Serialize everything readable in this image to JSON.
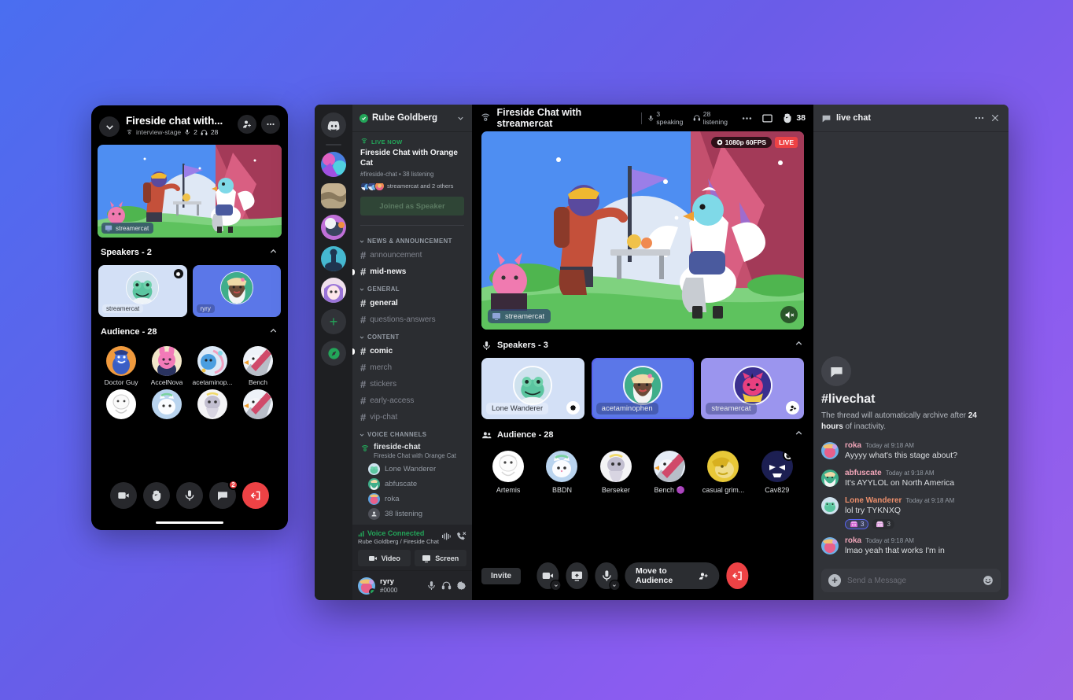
{
  "mobile": {
    "title": "Fireside chat with...",
    "channel": "interview-stage",
    "speaking_count": "2",
    "listening_count": "28",
    "stream_label": "streamercat",
    "speakers_section": {
      "label": "Speakers - 2"
    },
    "speakers": [
      {
        "name": "streamercat",
        "badge": "stage-moderator-icon"
      },
      {
        "name": "ryry",
        "badge": ""
      }
    ],
    "audience_section": {
      "label": "Audience - 28"
    },
    "audience": [
      {
        "name": "Doctor Guy"
      },
      {
        "name": "AccelNova"
      },
      {
        "name": "acetaminop..."
      },
      {
        "name": "Bench"
      }
    ],
    "toolbar": {
      "video": "video-icon",
      "raise_hand": "raise-hand-icon",
      "mic": "microphone-icon",
      "chat": "chat-icon",
      "chat_badge": "2",
      "leave": "leave-call-icon"
    }
  },
  "rail": {
    "home_label": "discord-home",
    "items": [
      "server-1",
      "server-2",
      "server-3",
      "server-4",
      "server-5"
    ],
    "add_label": "+",
    "explore_label": "explore-servers"
  },
  "sidebar": {
    "server_name": "Rube Goldberg",
    "live_card": {
      "live_now": "LIVE NOW",
      "title": "Fireside Chat with Orange Cat",
      "meta": "#fireside-chat  •  38 listening",
      "people": "streamercat and 2 others",
      "button": "Joined as Speaker"
    },
    "categories": [
      {
        "name": "NEWS & ANNOUNCEMENT",
        "channels": [
          {
            "name": "announcement",
            "unread": false
          },
          {
            "name": "mid-news",
            "unread": true
          }
        ]
      },
      {
        "name": "GENERAL",
        "channels": [
          {
            "name": "general",
            "unread": true
          },
          {
            "name": "questions-answers",
            "unread": false
          }
        ]
      },
      {
        "name": "CONTENT",
        "channels": [
          {
            "name": "comic",
            "unread": true
          },
          {
            "name": "merch",
            "unread": false
          },
          {
            "name": "stickers",
            "unread": false
          },
          {
            "name": "early-access",
            "unread": false
          },
          {
            "name": "vip-chat",
            "unread": false
          }
        ]
      }
    ],
    "voice_category": "VOICE CHANNELS",
    "voice_channel": {
      "name": "fireside-chat",
      "topic": "Fireside Chat with Orange Cat"
    },
    "voice_members": [
      {
        "name": "Lone Wanderer"
      },
      {
        "name": "abfuscate"
      },
      {
        "name": "roka"
      },
      {
        "name": "38 listening"
      }
    ],
    "voice_panel": {
      "status": "Voice Connected",
      "channel_path": "Rube Goldberg / Fireside Chat",
      "video_button": "Video",
      "screen_button": "Screen"
    },
    "user": {
      "name": "ryry",
      "tag": "#0000"
    }
  },
  "stage": {
    "title": "Fireside Chat with streamercat",
    "speaking": "3 speaking",
    "listening": "28 listening",
    "hand_count": "38",
    "video": {
      "quality": "1080p 60FPS",
      "live": "LIVE",
      "label": "streamercat"
    },
    "speakers_section": "Speakers - 3",
    "speakers": [
      {
        "name": "Lone Wanderer",
        "badge": "stage-moderator-icon",
        "active": false
      },
      {
        "name": "acetaminophen",
        "badge": "",
        "active": true
      },
      {
        "name": "streamercat",
        "badge": "invite-to-speak-icon",
        "active": false
      }
    ],
    "audience_section": "Audience - 28",
    "audience": [
      {
        "name": "Artemis",
        "badge": ""
      },
      {
        "name": "BBDN",
        "badge": ""
      },
      {
        "name": "Berseker",
        "badge": ""
      },
      {
        "name": "Bench 🟣",
        "badge": ""
      },
      {
        "name": "casual grim...",
        "badge": ""
      },
      {
        "name": "Cav829",
        "badge": "raise-hand-icon"
      }
    ],
    "toolbar": {
      "invite": "Invite",
      "video": "video-icon",
      "screen": "screen-share-icon",
      "mic": "microphone-icon",
      "move_to_audience": "Move to Audience",
      "leave": "leave-call-icon"
    }
  },
  "chat": {
    "header_title": "live chat",
    "intro_title": "#livechat",
    "intro_prefix": "The thread will automatically archive after ",
    "intro_bold": "24 hours",
    "intro_suffix": " of inactivity.",
    "messages": [
      {
        "author": "roka",
        "color": "#f0a5b8",
        "time": "Today at 9:18 AM",
        "text": "Ayyyy what's this stage about?",
        "reactions": []
      },
      {
        "author": "abfuscate",
        "color": "#f0a5b8",
        "time": "Today at 9:18 AM",
        "text": "It's AYYLOL on North America",
        "reactions": []
      },
      {
        "author": "Lone Wanderer",
        "color": "#ed8f6c",
        "time": "Today at 9:18 AM",
        "text": "lol try TYKNXQ",
        "reactions": [
          {
            "count": "3",
            "me": true
          },
          {
            "count": "3",
            "me": false
          }
        ]
      },
      {
        "author": "roka",
        "color": "#f0a5b8",
        "time": "Today at 9:18 AM",
        "text": "lmao yeah that works I'm in",
        "reactions": []
      }
    ],
    "input_placeholder": "Send a Message"
  },
  "colors": {
    "brand": "#5865f2",
    "danger": "#ed4245",
    "online": "#23a559",
    "speaker_card_light": "#d3e0f6",
    "speaker_card_blue": "#5b77e8",
    "speaker_card_purple": "#9b95ee"
  }
}
